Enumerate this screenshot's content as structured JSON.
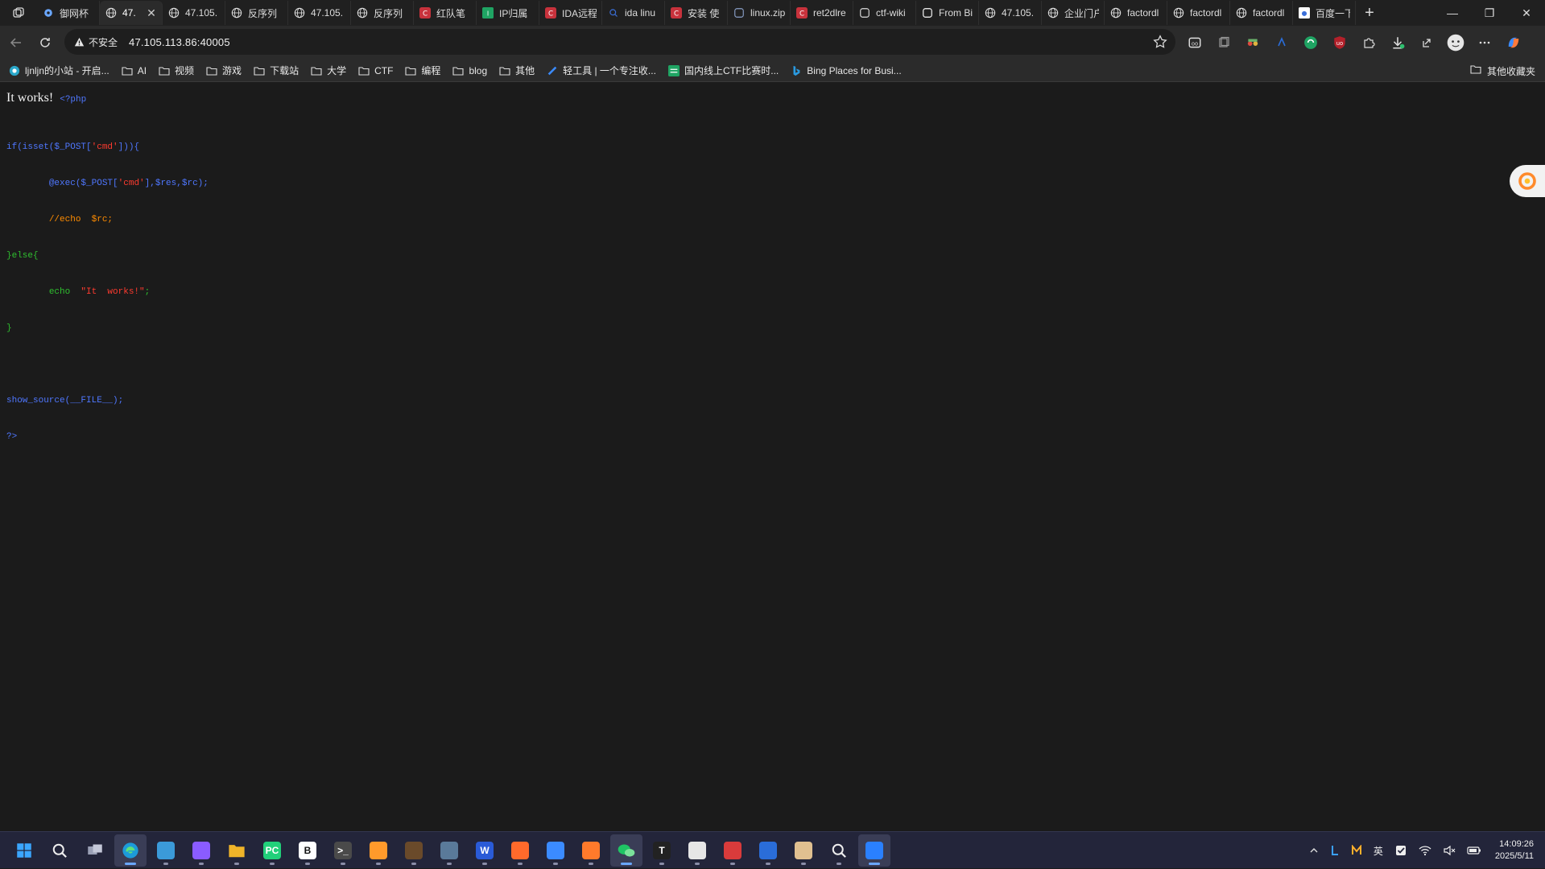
{
  "browser": {
    "tabs": [
      {
        "title": "御网杯",
        "favicon": "gear-icon",
        "active": false
      },
      {
        "title": "47.",
        "favicon": "globe-icon",
        "active": true
      },
      {
        "title": "47.105.",
        "favicon": "globe-icon",
        "active": false
      },
      {
        "title": "反序列",
        "favicon": "globe-icon",
        "active": false
      },
      {
        "title": "47.105.",
        "favicon": "globe-icon",
        "active": false
      },
      {
        "title": "反序列",
        "favicon": "globe-icon",
        "active": false
      },
      {
        "title": "红队笔",
        "favicon": "csdn-icon",
        "active": false
      },
      {
        "title": "IP归属",
        "favicon": "ip-icon",
        "active": false
      },
      {
        "title": "IDA远程",
        "favicon": "csdn-icon",
        "active": false
      },
      {
        "title": "ida linu",
        "favicon": "search-icon",
        "active": false
      },
      {
        "title": "安装 使",
        "favicon": "csdn-icon",
        "active": false
      },
      {
        "title": "linux.zip",
        "favicon": "page-icon",
        "active": false
      },
      {
        "title": "ret2dlre",
        "favicon": "csdn-icon",
        "active": false
      },
      {
        "title": "ctf-wiki",
        "favicon": "github-icon",
        "active": false
      },
      {
        "title": "From Bi",
        "favicon": "chef-icon",
        "active": false
      },
      {
        "title": "47.105.",
        "favicon": "globe-icon",
        "active": false
      },
      {
        "title": "企业门户",
        "favicon": "globe-icon",
        "active": false
      },
      {
        "title": "factordl",
        "favicon": "globe-icon",
        "active": false
      },
      {
        "title": "factordl",
        "favicon": "globe-icon",
        "active": false
      },
      {
        "title": "factordl",
        "favicon": "globe-icon",
        "active": false
      },
      {
        "title": "百度一下",
        "favicon": "baidu-icon",
        "active": false
      }
    ],
    "new_tab": "+",
    "window_controls": {
      "minimize": "—",
      "restore": "❐",
      "close": "✕"
    },
    "address": {
      "security_label": "不安全",
      "url": "47.105.113.86:40005"
    },
    "bookmarks": [
      {
        "label": "ljnljn的小站 - 开启...",
        "icon": "site-icon"
      },
      {
        "label": "AI",
        "icon": "folder-icon"
      },
      {
        "label": "视频",
        "icon": "folder-icon"
      },
      {
        "label": "游戏",
        "icon": "folder-icon"
      },
      {
        "label": "下载站",
        "icon": "folder-icon"
      },
      {
        "label": "大学",
        "icon": "folder-icon"
      },
      {
        "label": "CTF",
        "icon": "folder-icon"
      },
      {
        "label": "编程",
        "icon": "folder-icon"
      },
      {
        "label": "blog",
        "icon": "folder-icon"
      },
      {
        "label": "其他",
        "icon": "folder-icon"
      },
      {
        "label": "轻工具 | 一个专注收...",
        "icon": "tool-icon"
      },
      {
        "label": "国内线上CTF比赛时...",
        "icon": "ctf-icon"
      },
      {
        "label": "Bing Places for Busi...",
        "icon": "bing-icon"
      }
    ],
    "other_bookmarks": "其他收藏夹"
  },
  "page": {
    "heading": "It works!",
    "php_open": "<?php",
    "code": {
      "l1_a": "if(isset($_POST[",
      "l1_b": "'cmd'",
      "l1_c": "])){",
      "l2_indent": "        ",
      "l2_a": "@exec($_POST[",
      "l2_b": "'cmd'",
      "l2_c": "],$res,$rc);",
      "l3_indent": "        ",
      "l3": "//echo  $rc;",
      "l4": "}else{",
      "l5_indent": "        ",
      "l5_a": "echo  ",
      "l5_b": "\"It  works!\"",
      "l5_c": ";",
      "l6": "}",
      "l8_a": "show_source(__FILE__);",
      "l9": "?>"
    }
  },
  "taskbar": {
    "apps": [
      {
        "name": "start-icon",
        "active": false
      },
      {
        "name": "search-icon",
        "active": false
      },
      {
        "name": "task-view-icon",
        "active": false
      },
      {
        "name": "edge-icon",
        "active": true
      },
      {
        "name": "app-icon",
        "active": false
      },
      {
        "name": "app-icon",
        "active": false
      },
      {
        "name": "folder-icon",
        "active": false
      },
      {
        "name": "pycharm-icon",
        "active": false,
        "label": "PC"
      },
      {
        "name": "burp-icon",
        "active": false,
        "label": "B"
      },
      {
        "name": "terminal-icon",
        "active": false,
        "label": ">_"
      },
      {
        "name": "app-icon",
        "active": false
      },
      {
        "name": "app-icon",
        "active": false
      },
      {
        "name": "app-icon",
        "active": false
      },
      {
        "name": "word-icon",
        "active": false,
        "label": "W"
      },
      {
        "name": "search-app-icon",
        "active": false
      },
      {
        "name": "app-icon",
        "active": false
      },
      {
        "name": "app-icon",
        "active": false
      },
      {
        "name": "wechat-icon",
        "active": true
      },
      {
        "name": "typora-icon",
        "active": false,
        "label": "T"
      },
      {
        "name": "notes-icon",
        "active": false
      },
      {
        "name": "app-icon",
        "active": false
      },
      {
        "name": "app-icon",
        "active": false
      },
      {
        "name": "app-icon",
        "active": false
      },
      {
        "name": "magnifier-icon",
        "active": false
      },
      {
        "name": "app-icon",
        "active": true
      }
    ],
    "tray": {
      "ime": "英",
      "time": "14:09:26",
      "date": "2025/5/11"
    }
  },
  "colors": {
    "keyword": "#4f77ff",
    "string": "#ff3b2f",
    "comment": "#ff8c00",
    "default": "#2fbf2f"
  }
}
